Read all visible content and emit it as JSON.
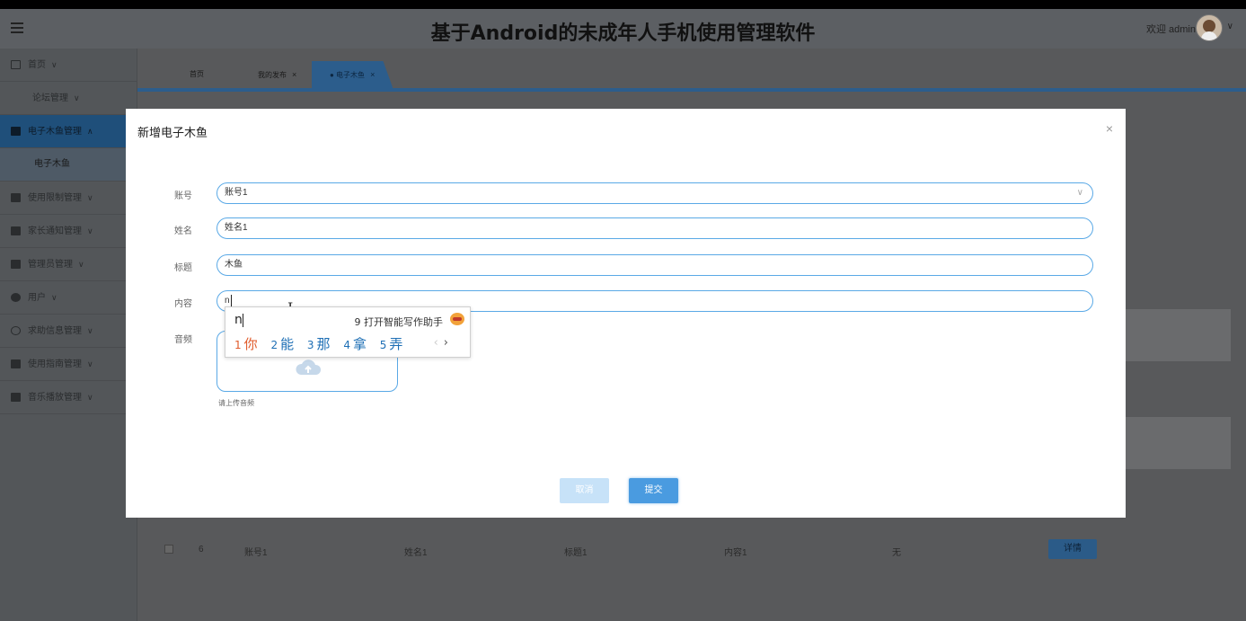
{
  "header": {
    "title": "基于Android的未成年人手机使用管理软件",
    "welcome": "欢迎 admin"
  },
  "sidebar": {
    "items": [
      {
        "label": "首页",
        "icon": "home-icon"
      },
      {
        "label": "论坛管理",
        "icon": ""
      },
      {
        "label": "电子木鱼管理",
        "icon": "folder-icon"
      },
      {
        "label": "电子木鱼",
        "icon": ""
      },
      {
        "label": "使用限制管理",
        "icon": "layout-icon"
      },
      {
        "label": "家长通知管理",
        "icon": "list-icon"
      },
      {
        "label": "管理员管理",
        "icon": "grid-icon"
      },
      {
        "label": "用户",
        "icon": "user-icon"
      },
      {
        "label": "求助信息管理",
        "icon": "circle-icon"
      },
      {
        "label": "使用指南管理",
        "icon": "book-icon"
      },
      {
        "label": "音乐播放管理",
        "icon": "music-icon"
      }
    ]
  },
  "tabs": [
    {
      "label": "首页"
    },
    {
      "label": "我的发布"
    },
    {
      "label": "● 电子木鱼"
    }
  ],
  "tab_close": "×",
  "background_row": {
    "index": "6",
    "account": "账号1",
    "name": "姓名1",
    "title": "标题1",
    "content": "内容1",
    "audio": "无",
    "detail_button": "详情"
  },
  "modal": {
    "title": "新增电子木鱼",
    "close": "×",
    "fields": {
      "account_label": "账号",
      "account_value": "账号1",
      "name_label": "姓名",
      "name_value": "姓名1",
      "title_label": "标题",
      "title_value": "木鱼",
      "content_label": "内容",
      "content_value": "n",
      "audio_label": "音频",
      "audio_hint": "请上传音频"
    },
    "cancel_button": "取消",
    "submit_button": "提交"
  },
  "ime": {
    "input": "n",
    "assist": "9 打开智能写作助手",
    "candidates": [
      {
        "num": "1",
        "text": "你"
      },
      {
        "num": "2",
        "text": "能"
      },
      {
        "num": "3",
        "text": "那"
      },
      {
        "num": "4",
        "text": "拿"
      },
      {
        "num": "5",
        "text": "弄"
      }
    ],
    "prev": "‹",
    "next": "›"
  },
  "colors": {
    "accent": "#4a9be0",
    "active_menu": "#1f4f7a",
    "input_border": "#5aa9e6"
  }
}
